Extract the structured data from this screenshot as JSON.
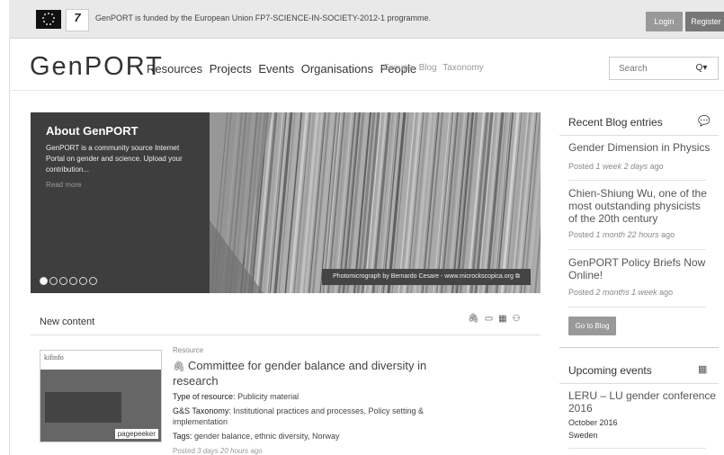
{
  "topbar": {
    "funded_text": "GenPORT is funded by the European Union FP7-SCIENCE-IN-SOCIETY-2012-1 programme.",
    "fp7_logo_text": "7",
    "login": "Login",
    "register": "Register"
  },
  "header": {
    "logo": "GenPORT",
    "main_nav": [
      "Resources",
      "Projects",
      "Events",
      "Organisations",
      "People"
    ],
    "sub_nav": [
      "Groups",
      "Blog",
      "Taxonomy"
    ],
    "search_placeholder": "Search",
    "search_button": "Q▾"
  },
  "slider": {
    "title": "About GenPORT",
    "text": "GenPORT is a community source Internet Portal on gender and science. Upload your contribution...",
    "read_more": "Read more",
    "caption": "Photomicrograph by Bernardo Cesare - www.microckscopica.org",
    "slide_count": 6,
    "active_slide": 1
  },
  "new_content": {
    "title": "New content",
    "icons": [
      "paperclip-icon",
      "book-icon",
      "calendar-icon",
      "people-icon"
    ],
    "item": {
      "category": "Resource",
      "title": "Committee for gender balance and diversity in research",
      "type_label": "Type of resource:",
      "type_value": "Publicity material",
      "taxonomy_label": "G&S Taxonomy:",
      "taxonomy_value": "Institutional practices and processes, Policy setting & implementation",
      "tags_label": "Tags:",
      "tags_value": "gender balance, ethnic diversity, Norway",
      "posted_prefix": "Posted",
      "posted_time": "3 days 20 hours",
      "posted_suffix": "ago",
      "thumb_brand": "kifinfo",
      "thumb_badge": "pagepeeker"
    }
  },
  "sidebar": {
    "blog_title": "Recent Blog entries",
    "entries": [
      {
        "title": "Gender Dimension in Physics",
        "prefix": "Posted",
        "time": "1 week 2 days",
        "suffix": "ago"
      },
      {
        "title": "Chien-Shiung Wu, one of the most outstanding physicists of the 20th century",
        "prefix": "Posted",
        "time": "1 month 22 hours",
        "suffix": "ago"
      },
      {
        "title": "GenPORT Policy Briefs Now Online!",
        "prefix": "Posted",
        "time": "2 months 1 week",
        "suffix": "ago"
      }
    ],
    "go_to_blog": "Go to Blog",
    "events_title": "Upcoming events",
    "event": {
      "title": "LERU – LU gender conference 2016",
      "date": "October 2016",
      "place": "Sweden"
    }
  }
}
